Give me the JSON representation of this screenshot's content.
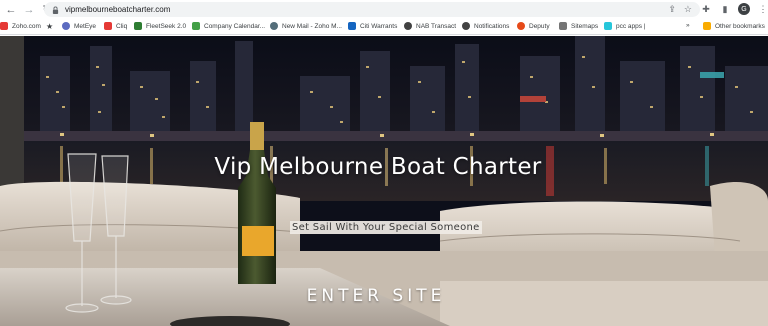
{
  "browser": {
    "url": "vipmelbourneboatcharter.com",
    "avatar_initial": "G",
    "bookmarks": [
      {
        "label": "Zoho.com",
        "color": "#e53935"
      },
      {
        "label": "MetEye",
        "color": "#5c6bc0"
      },
      {
        "label": "Cliq",
        "color": "#e53935"
      },
      {
        "label": "FleetSeek 2.0",
        "color": "#2e7d32"
      },
      {
        "label": "Company Calendar...",
        "color": "#43a047"
      },
      {
        "label": "New Mail - Zoho M...",
        "color": "#546e7a"
      },
      {
        "label": "Citi Warrants",
        "color": "#1565c0"
      },
      {
        "label": "NAB Transact",
        "color": "#424242"
      },
      {
        "label": "Notifications",
        "color": "#424242"
      },
      {
        "label": "Deputy",
        "color": "#e64a19"
      },
      {
        "label": "Sitemaps",
        "color": "#757575"
      },
      {
        "label": "pcc apps |",
        "color": "#26c6da"
      }
    ],
    "more_label": "»",
    "other_bookmarks": "Other bookmarks"
  },
  "hero": {
    "title": "Vip Melbourne Boat Charter",
    "subtitle": "Set Sail With Your Special Someone",
    "enter_label": "ENTER SITE",
    "bottle_label": "Veuve Clicquot"
  }
}
